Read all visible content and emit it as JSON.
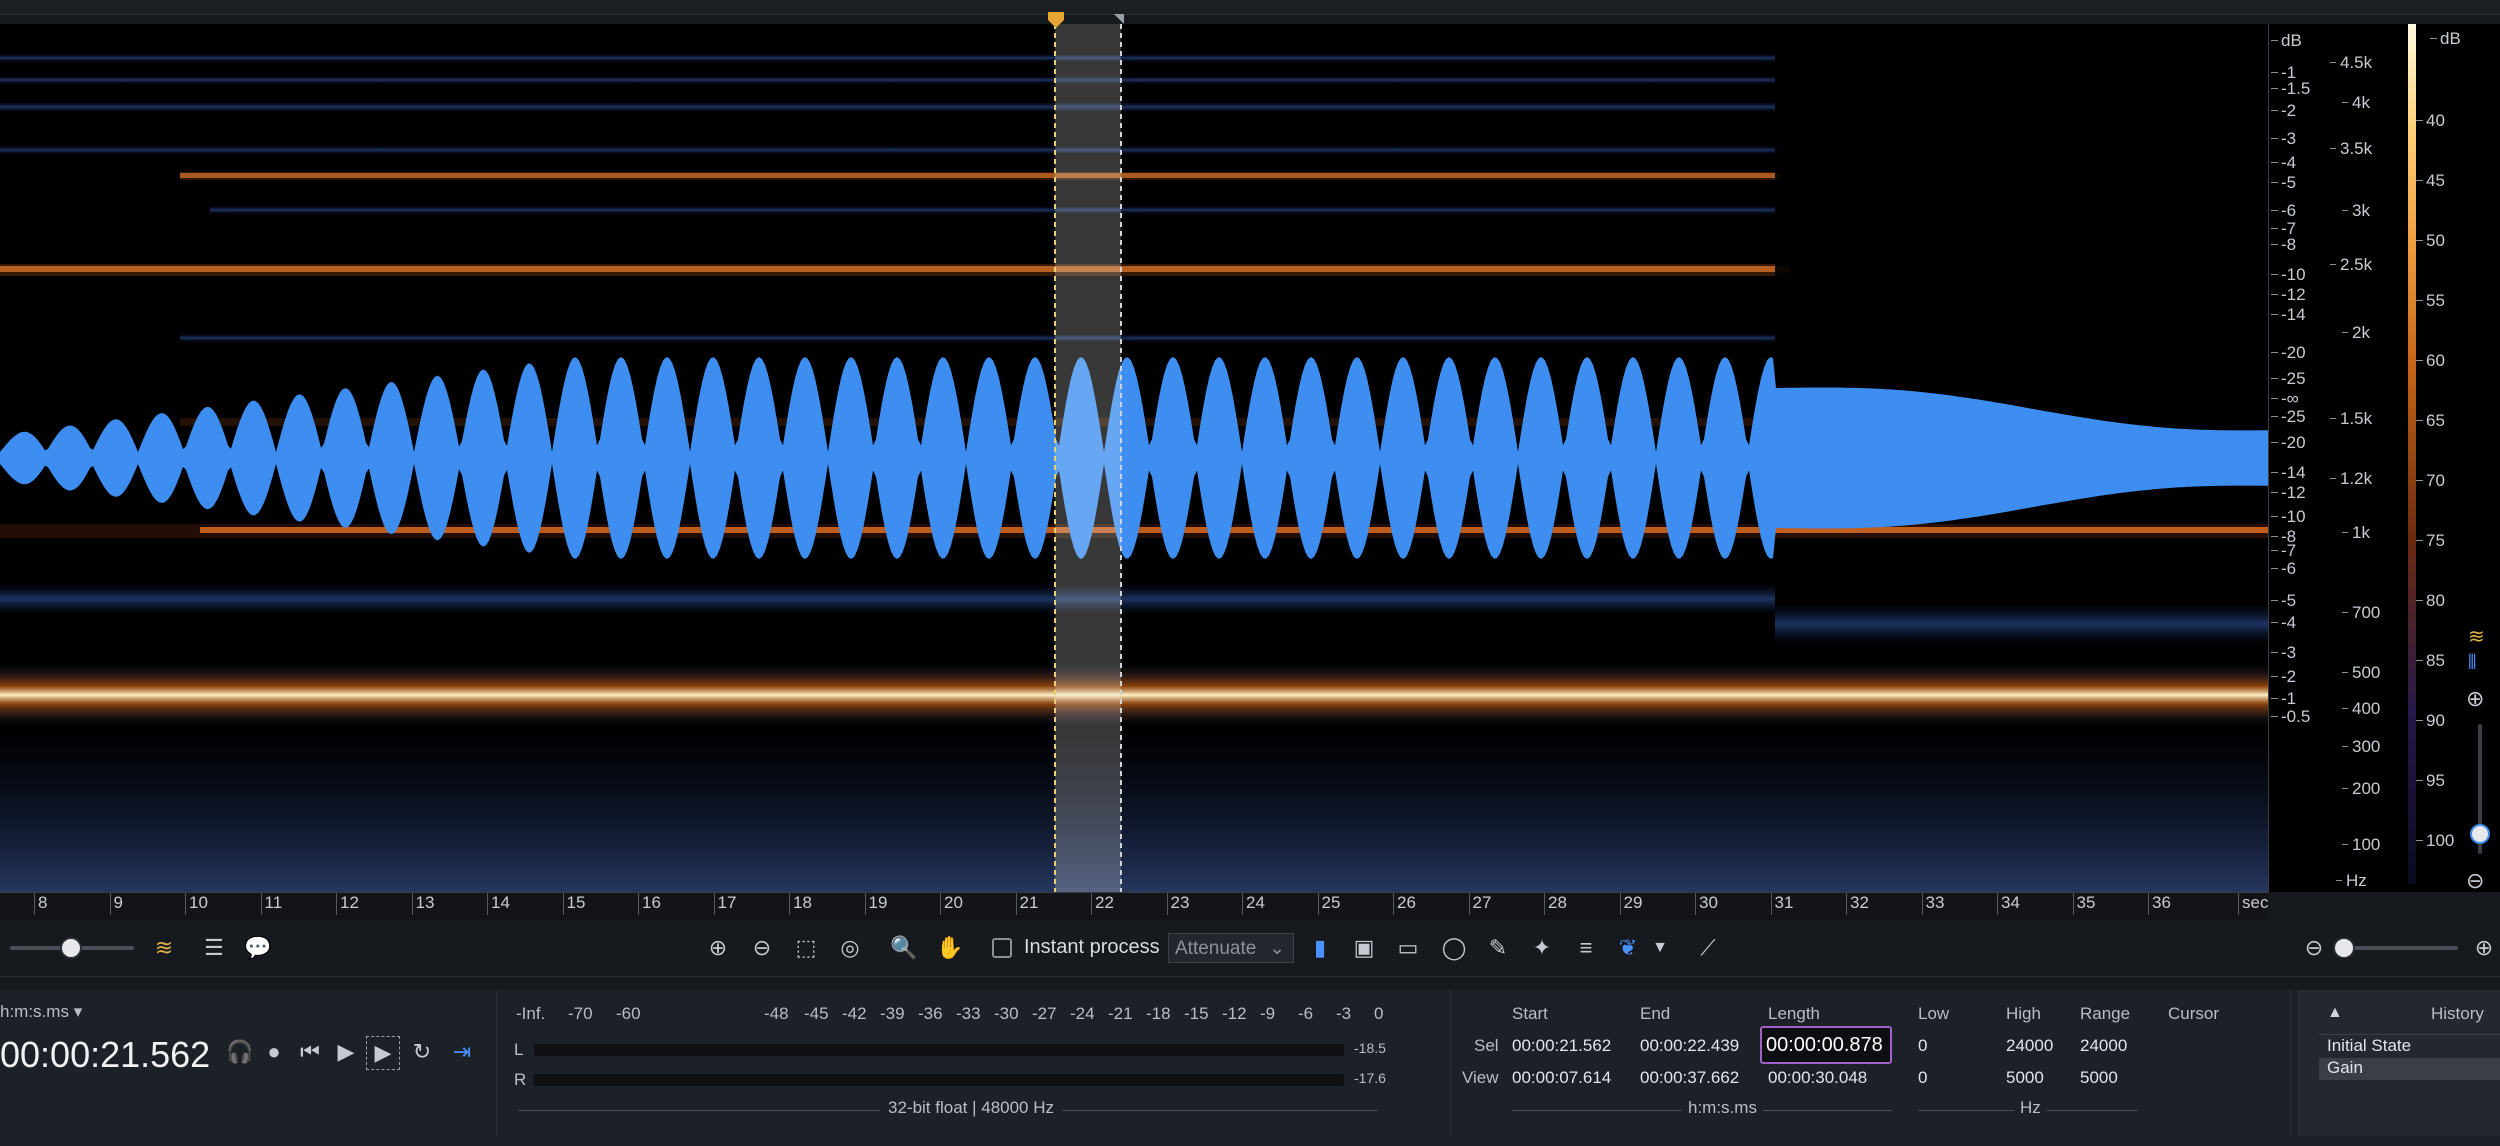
{
  "spectrogram": {
    "db_scale_label": "dB",
    "db_ticks": [
      "-1",
      "-1.5",
      "-2",
      "-3",
      "-4",
      "-5",
      "-6",
      "-7",
      "-8",
      "-10",
      "-12",
      "-14",
      "-20",
      "-25",
      "-∞",
      "-25",
      "-20",
      "-14",
      "-12",
      "-10",
      "-8",
      "-7",
      "-6",
      "-5",
      "-4",
      "-3",
      "-2",
      "-1",
      "-0.5"
    ],
    "hz_ticks": [
      "4.5k",
      "4k",
      "3.5k",
      "3k",
      "2.5k",
      "2k",
      "1.5k",
      "1.2k",
      "1k",
      "700",
      "500",
      "400",
      "300",
      "200",
      "100"
    ],
    "hz_unit": "Hz",
    "colorbar_label": "dB",
    "colorbar_ticks": [
      "40",
      "45",
      "50",
      "55",
      "60",
      "65",
      "70",
      "75",
      "80",
      "85",
      "90",
      "95",
      "100"
    ],
    "time_ticks": [
      "8",
      "9",
      "10",
      "11",
      "12",
      "13",
      "14",
      "15",
      "16",
      "17",
      "18",
      "19",
      "20",
      "21",
      "22",
      "23",
      "24",
      "25",
      "26",
      "27",
      "28",
      "29",
      "30",
      "31",
      "32",
      "33",
      "34",
      "35",
      "36"
    ],
    "time_unit": "sec"
  },
  "toolbar": {
    "instant_process_label": "Instant process",
    "attenuate_label": "Attenuate"
  },
  "transport": {
    "time_format": "h:m:s.ms",
    "time_display": "00:00:21.562"
  },
  "meter": {
    "scale": [
      "-Inf.",
      "-70",
      "-60",
      "-48",
      "-45",
      "-42",
      "-39",
      "-36",
      "-33",
      "-30",
      "-27",
      "-24",
      "-21",
      "-18",
      "-15",
      "-12",
      "-9",
      "-6",
      "-3",
      "0"
    ],
    "channel_l": "L",
    "channel_r": "R",
    "peak_l": "-18.5",
    "peak_r": "-17.6",
    "format_info": "32-bit float | 48000 Hz"
  },
  "selection": {
    "start_header": "Start",
    "end_header": "End",
    "length_header": "Length",
    "sel_label": "Sel",
    "view_label": "View",
    "sel_start": "00:00:21.562",
    "sel_end": "00:00:22.439",
    "sel_length": "00:00:00.878",
    "view_start": "00:00:07.614",
    "view_end": "00:00:37.662",
    "view_length": "00:00:30.048",
    "time_unit": "h:m:s.ms",
    "low_header": "Low",
    "high_header": "High",
    "range_header": "Range",
    "sel_low": "0",
    "sel_high": "24000",
    "sel_range": "24000",
    "view_low": "0",
    "view_high": "5000",
    "view_range": "5000",
    "freq_unit": "Hz",
    "cursor_header": "Cursor"
  },
  "history": {
    "title": "History",
    "items": [
      "Initial State",
      "Gain"
    ]
  },
  "colors": {
    "waveform": "#3d8ef0",
    "selection_marker": "#e6a532",
    "hot": "#ffb347"
  }
}
